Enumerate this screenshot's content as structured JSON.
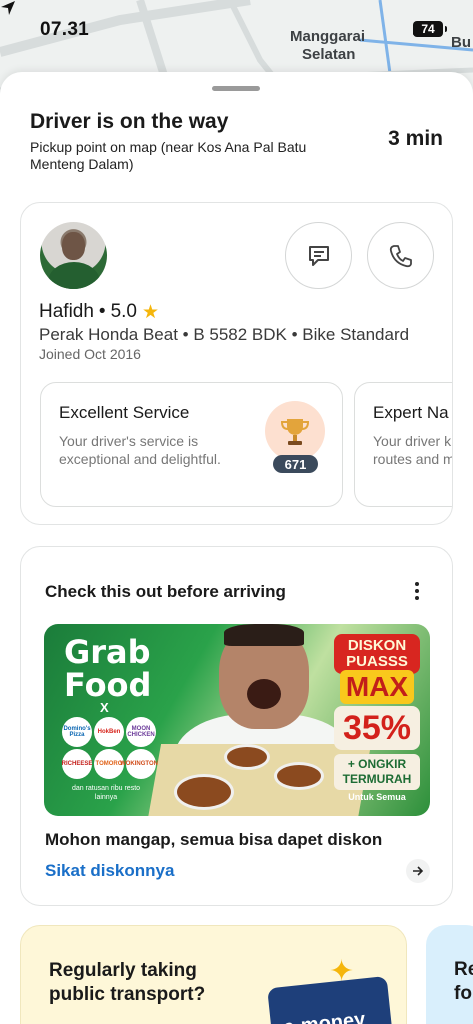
{
  "status_bar": {
    "time": "07.31",
    "battery": "74"
  },
  "map": {
    "labels": [
      "Manggarai",
      "Selatan",
      "Bu"
    ]
  },
  "trip": {
    "title": "Driver is on the way",
    "subtitle": "Pickup point on map (near Kos Ana Pal Batu Menteng Dalam)",
    "eta": "3 min"
  },
  "driver": {
    "name": "Hafidh",
    "separator": "•",
    "rating": "5.0",
    "vehicle": "Perak Honda Beat • B 5582 BDK • Bike Standard",
    "joined": "Joined Oct 2016",
    "compliments": [
      {
        "title": "Excellent Service",
        "description": "Your driver's service is exceptional and delightful.",
        "count": "671"
      },
      {
        "title": "Expert Na",
        "description": "Your driver k routes and m"
      }
    ]
  },
  "promo": {
    "section_title": "Check this out before arriving",
    "banner": {
      "brand": "Grab Food",
      "x": "X",
      "partners": [
        "Domino's Pizza",
        "HokBen",
        "MOON CHICKEN",
        "RICHEESE",
        "TOMORO",
        "WOKINGTONS"
      ],
      "sub": "dan ratusan ribu resto lainnya",
      "diskon": "DISKON PUASSS",
      "max": "MAX",
      "percent": "35%",
      "ongkir": "+ ONGKIR TERMURAH",
      "untuk": "Untuk Semua"
    },
    "title": "Mohon mangap, semua bisa dapet diskon",
    "link": "Sikat diskonnya"
  },
  "bottom_cards": [
    {
      "text": "Regularly taking public transport?",
      "card_label": "e-money"
    },
    {
      "text": "Re fo"
    }
  ]
}
